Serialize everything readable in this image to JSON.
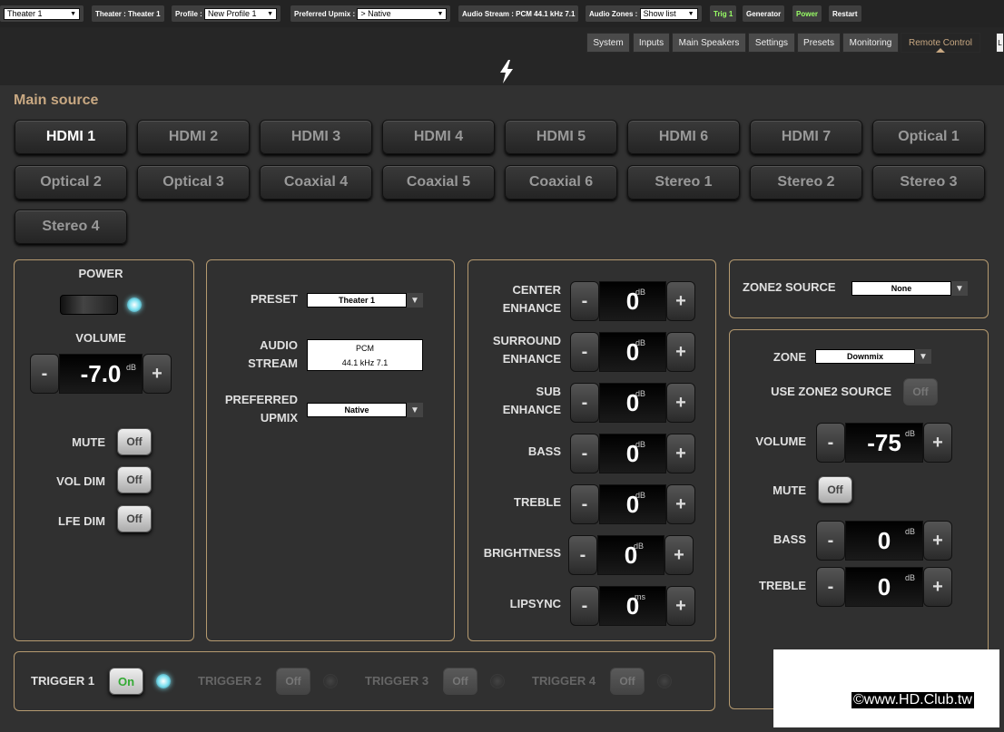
{
  "topbar": {
    "theater_select": "Theater 1",
    "theater_label": "Theater : Theater 1",
    "profile_label": "Profile :",
    "profile_select": "New Profile 1",
    "upmix_label": "Preferred Upmix :",
    "upmix_select": "> Native",
    "audio_stream": "Audio Stream : PCM 44.1 kHz 7.1",
    "audio_zones_label": "Audio Zones :",
    "audio_zones_select": "Show list",
    "trig1": "Trig 1",
    "generator": "Generator",
    "power": "Power",
    "restart": "Restart"
  },
  "nav": {
    "tabs": [
      "System",
      "Inputs",
      "Main Speakers",
      "Settings",
      "Presets",
      "Monitoring",
      "Remote Control"
    ],
    "active": "Remote Control",
    "overflow": "L"
  },
  "logo_icon": "lightning-bolt-icon",
  "main_source": {
    "title": "Main source",
    "buttons": [
      "HDMI 1",
      "HDMI 2",
      "HDMI 3",
      "HDMI 4",
      "HDMI 5",
      "HDMI 6",
      "HDMI 7",
      "Optical 1",
      "Optical 2",
      "Optical 3",
      "Coaxial 4",
      "Coaxial 5",
      "Coaxial 6",
      "Stereo 1",
      "Stereo 2",
      "Stereo 3",
      "Stereo 4"
    ],
    "selected": "HDMI 1"
  },
  "power_panel": {
    "power_label": "POWER",
    "volume_label": "VOLUME",
    "volume_value": "-7.0",
    "volume_unit": "dB",
    "mute_label": "MUTE",
    "mute_state": "Off",
    "vol_dim_label": "VOL DIM",
    "vol_dim_state": "Off",
    "lfe_dim_label": "LFE DIM",
    "lfe_dim_state": "Off"
  },
  "preset_panel": {
    "preset_label": "PRESET",
    "preset_value": "Theater 1",
    "audio_stream_label_1": "AUDIO",
    "audio_stream_label_2": "STREAM",
    "audio_stream_line1": "PCM",
    "audio_stream_line2": "44.1 kHz 7.1",
    "upmix_label_1": "PREFERRED",
    "upmix_label_2": "UPMIX",
    "upmix_value": "Native"
  },
  "eq_panel": {
    "rows": [
      {
        "label1": "CENTER",
        "label2": "ENHANCE",
        "value": "0",
        "unit": "dB"
      },
      {
        "label1": "SURROUND",
        "label2": "ENHANCE",
        "value": "0",
        "unit": "dB"
      },
      {
        "label1": "SUB",
        "label2": "ENHANCE",
        "value": "0",
        "unit": "dB"
      },
      {
        "label1": "BASS",
        "label2": "",
        "value": "0",
        "unit": "dB"
      },
      {
        "label1": "TREBLE",
        "label2": "",
        "value": "0",
        "unit": "dB"
      },
      {
        "label1": "BRIGHTNESS",
        "label2": "",
        "value": "0",
        "unit": "dB"
      },
      {
        "label1": "LIPSYNC",
        "label2": "",
        "value": "0",
        "unit": "ms"
      }
    ],
    "minus": "-",
    "plus": "+"
  },
  "zone2_source": {
    "label": "ZONE2 SOURCE",
    "value": "None"
  },
  "zone_panel": {
    "zone_label": "ZONE",
    "zone_value": "Downmix",
    "use_zone2_label": "USE ZONE2 SOURCE",
    "use_zone2_state": "Off",
    "volume_label": "VOLUME",
    "volume_value": "-75",
    "volume_unit": "dB",
    "mute_label": "MUTE",
    "mute_state": "Off",
    "bass_label": "BASS",
    "bass_value": "0",
    "bass_unit": "dB",
    "treble_label": "TREBLE",
    "treble_value": "0",
    "treble_unit": "dB"
  },
  "triggers": {
    "items": [
      {
        "label": "TRIGGER 1",
        "state": "On"
      },
      {
        "label": "TRIGGER 2",
        "state": "Off"
      },
      {
        "label": "TRIGGER 3",
        "state": "Off"
      },
      {
        "label": "TRIGGER 4",
        "state": "Off"
      }
    ]
  },
  "watermark": "©www.HD.Club.tw"
}
